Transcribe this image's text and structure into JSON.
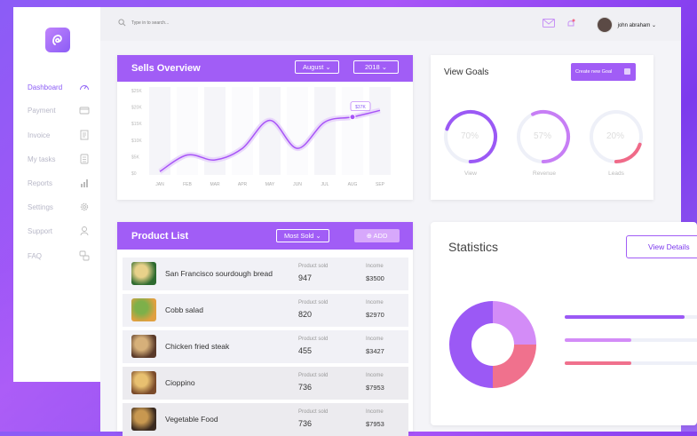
{
  "sidebar": {
    "items": [
      {
        "label": "Dashboard",
        "icon": "dashboard-gauge-icon",
        "active": true
      },
      {
        "label": "Payment",
        "icon": "payment-card-icon"
      },
      {
        "label": "Invoice",
        "icon": "invoice-icon"
      },
      {
        "label": "My tasks",
        "icon": "tasks-icon"
      },
      {
        "label": "Reports",
        "icon": "reports-chart-icon"
      },
      {
        "label": "Settings",
        "icon": "settings-gear-icon"
      },
      {
        "label": "Support",
        "icon": "support-icon"
      },
      {
        "label": "FAQ",
        "icon": "faq-icon"
      }
    ]
  },
  "topbar": {
    "search_placeholder": "Type in to search...",
    "username": "john abraham ⌄"
  },
  "sells": {
    "title": "Sells Overview",
    "month": "August ⌄",
    "year": "2018 ⌄"
  },
  "chart_data": {
    "type": "line",
    "categories": [
      "JAN",
      "FEB",
      "MAR",
      "APR",
      "MAY",
      "JUN",
      "JUL",
      "AUG",
      "SEP"
    ],
    "values": [
      2,
      22,
      16,
      30,
      64,
      30,
      62,
      68,
      76
    ],
    "yticks": [
      "$0",
      "$5K",
      "$10K",
      "$15K",
      "$20K",
      "$25K"
    ],
    "ylim": [
      0,
      100
    ],
    "annotation": "$37K",
    "color": "#a855f7"
  },
  "goals": {
    "title": "View Goals",
    "button": "Create new Goal",
    "items": [
      {
        "pct": "70%",
        "label": "View",
        "value": 0.7,
        "color": "#9b59f5"
      },
      {
        "pct": "57%",
        "label": "Revenue",
        "value": 0.57,
        "color": "#c77ef5"
      },
      {
        "pct": "20%",
        "label": "Leads",
        "value": 0.2,
        "color": "#f06a88"
      }
    ]
  },
  "products": {
    "title": "Product List",
    "filter": "Most Sold ⌄",
    "add": "⊕ ADD",
    "rows": [
      {
        "name": "San Francisco sourdough bread",
        "sold_label": "Product sold",
        "sold": "947",
        "income_label": "Income",
        "income": "$3500"
      },
      {
        "name": "Cobb salad",
        "sold_label": "Product sold",
        "sold": "820",
        "income_label": "Income",
        "income": "$2970"
      },
      {
        "name": "Chicken fried steak",
        "sold_label": "Product sold",
        "sold": "455",
        "income_label": "Income",
        "income": "$3427"
      },
      {
        "name": "Cioppino",
        "sold_label": "Product sold",
        "sold": "736",
        "income_label": "Income",
        "income": "$7953"
      },
      {
        "name": "Vegetable Food",
        "sold_label": "Product sold",
        "sold": "736",
        "income_label": "Income",
        "income": "$7953"
      }
    ]
  },
  "stats": {
    "title": "Statistics",
    "button": "View Details",
    "slices": [
      {
        "value": 25,
        "color": "#d38cf7"
      },
      {
        "value": 25,
        "color": "#f0718d"
      },
      {
        "value": 50,
        "color": "#9b59f5"
      }
    ],
    "bars": [
      {
        "fill": 0.9,
        "color": "#9b59f5"
      },
      {
        "fill": 0.5,
        "color": "#d38cf7"
      },
      {
        "fill": 0.5,
        "color": "#f0718d"
      }
    ]
  }
}
